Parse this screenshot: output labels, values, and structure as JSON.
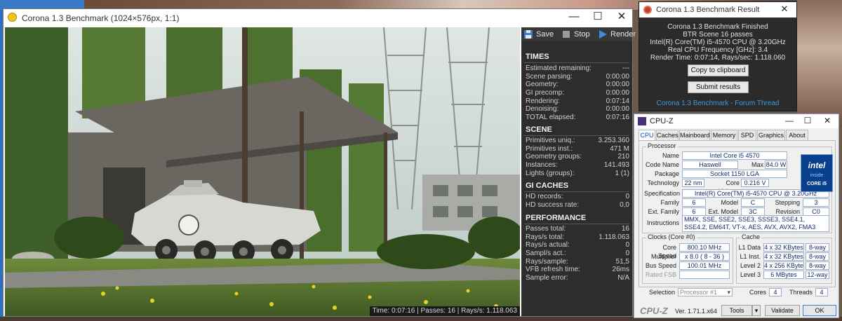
{
  "colors": {
    "vfb_panel": "#2d2d2d",
    "result_link": "#3b9be0",
    "cpuz_field_text": "#1a2a6c",
    "intel_blue": "#0a3f8e"
  },
  "vfb": {
    "title": "Corona 1.3 Benchmark (1024×576px, 1:1)",
    "window_buttons": {
      "minimize": "—",
      "maximize": "☐",
      "close": "✕"
    },
    "toolbar": {
      "save": "Save",
      "stop": "Stop",
      "render": "Render"
    },
    "status_bar": "Time: 0:07:16 | Passes: 16 | Rays/s: 1.118.063",
    "times": {
      "header": "TIMES",
      "rows": [
        {
          "k": "Estimated remaining:",
          "v": "---"
        },
        {
          "k": "Scene parsing:",
          "v": "0:00:00"
        },
        {
          "k": "Geometry:",
          "v": "0:00:00"
        },
        {
          "k": "GI precomp:",
          "v": "0:00:00"
        },
        {
          "k": "Rendering:",
          "v": "0:07:14"
        },
        {
          "k": "Denoising:",
          "v": "0:00:00"
        },
        {
          "k": "TOTAL elapsed:",
          "v": "0:07:16"
        }
      ]
    },
    "scene": {
      "header": "SCENE",
      "rows": [
        {
          "k": "Primitives uniq.:",
          "v": "3.253.360"
        },
        {
          "k": "Primitives inst.:",
          "v": "471 M"
        },
        {
          "k": "Geometry groups:",
          "v": "210"
        },
        {
          "k": "Instances:",
          "v": "141.493"
        },
        {
          "k": "Lights (groups):",
          "v": "1 (1)"
        }
      ]
    },
    "gi": {
      "header": "GI CACHES",
      "rows": [
        {
          "k": "HD records:",
          "v": "0"
        },
        {
          "k": "HD success rate:",
          "v": "0,0"
        }
      ]
    },
    "performance": {
      "header": "PERFORMANCE",
      "rows": [
        {
          "k": "Passes total:",
          "v": "16"
        },
        {
          "k": "Rays/s total:",
          "v": "1.118.063"
        },
        {
          "k": "Rays/s actual:",
          "v": "0"
        },
        {
          "k": "Sampl/s act.:",
          "v": "0"
        },
        {
          "k": "Rays/sample:",
          "v": "51,5"
        },
        {
          "k": "VFB refresh time:",
          "v": "26ms"
        },
        {
          "k": "Sample error:",
          "v": "N/A"
        }
      ]
    }
  },
  "result": {
    "title": "Corona 1.3 Benchmark Result",
    "close": "✕",
    "lines": [
      "Corona 1.3 Benchmark Finished",
      "BTR Scene 16 passes",
      "Intel(R) Core(TM) i5-4570 CPU @ 3.20GHz",
      "Real CPU Frequency [GHz]: 3.4",
      "Render Time: 0:07:14, Rays/sec: 1.118.060"
    ],
    "copy_button": "Copy to clipboard",
    "submit_button": "Submit results",
    "forum_link": "Corona 1.3 Benchmark - Forum Thread"
  },
  "cpuz": {
    "title": "CPU-Z",
    "window_buttons": {
      "minimize": "—",
      "maximize": "☐",
      "close": "✕"
    },
    "tabs": [
      "CPU",
      "Caches",
      "Mainboard",
      "Memory",
      "SPD",
      "Graphics",
      "About"
    ],
    "processor": {
      "header": "Processor",
      "name_label": "Name",
      "name": "Intel Core i5 4570",
      "codename_label": "Code Name",
      "codename": "Haswell",
      "maxtdp_label": "Max TDP",
      "maxtdp": "84.0 W",
      "package_label": "Package",
      "package": "Socket 1150 LGA",
      "technology_label": "Technology",
      "technology": "22 nm",
      "corevoltage_label": "Core Voltage",
      "corevoltage": "0.216 V",
      "spec_label": "Specification",
      "spec": "Intel(R) Core(TM) i5-4570 CPU @ 3.20GHz",
      "family_label": "Family",
      "family": "6",
      "model_label": "Model",
      "model": "C",
      "stepping_label": "Stepping",
      "stepping": "3",
      "extfamily_label": "Ext. Family",
      "extfamily": "6",
      "extmodel_label": "Ext. Model",
      "extmodel": "3C",
      "revision_label": "Revision",
      "revision": "C0",
      "instructions_label": "Instructions",
      "instructions": "MMX, SSE, SSE2, SSE3, SSSE3, SSE4.1, SSE4.2, EM64T, VT-x, AES, AVX, AVX2, FMA3"
    },
    "intel_logo": {
      "brand": "intel",
      "inside": "inside",
      "core": "CORE i5"
    },
    "clocks": {
      "header": "Clocks (Core #0)",
      "corespeed_label": "Core Speed",
      "corespeed": "800.10 MHz",
      "multiplier_label": "Multiplier",
      "multiplier": "x 8.0 ( 8 - 36 )",
      "busspeed_label": "Bus Speed",
      "busspeed": "100.01 MHz",
      "ratedfsb_label": "Rated FSB",
      "ratedfsb": ""
    },
    "cache": {
      "header": "Cache",
      "l1d_label": "L1 Data",
      "l1d": "4 x 32 KBytes",
      "l1d_way": "8-way",
      "l1i_label": "L1 Inst.",
      "l1i": "4 x 32 KBytes",
      "l1i_way": "8-way",
      "l2_label": "Level 2",
      "l2": "4 x 256 KBytes",
      "l2_way": "8-way",
      "l3_label": "Level 3",
      "l3": "6 MBytes",
      "l3_way": "12-way"
    },
    "selection_label": "Selection",
    "selection": "Processor #1",
    "cores_label": "Cores",
    "cores": "4",
    "threads_label": "Threads",
    "threads": "4",
    "footer": {
      "logo": "CPU-Z",
      "version": "Ver. 1.71.1.x64",
      "tools": "Tools",
      "validate": "Validate",
      "ok": "OK"
    }
  }
}
